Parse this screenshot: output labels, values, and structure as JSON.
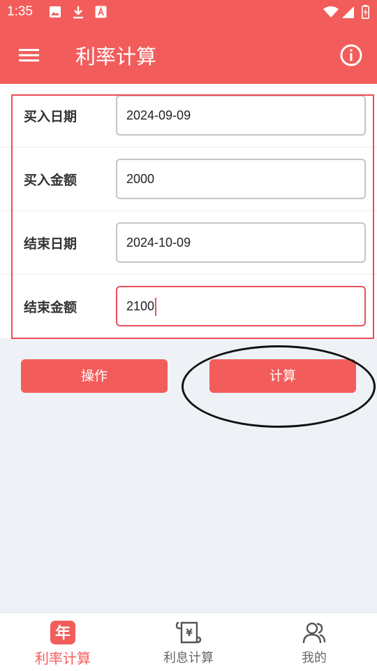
{
  "status_bar": {
    "time": "1:35",
    "icons": [
      "image-icon",
      "download-icon",
      "font-icon",
      "wifi-icon",
      "signal-icon",
      "battery-icon"
    ]
  },
  "app_bar": {
    "title": "利率计算",
    "menu_icon": "menu-icon",
    "info_icon": "info-icon"
  },
  "form": {
    "rows": [
      {
        "label": "买入日期",
        "value": "2024-09-09"
      },
      {
        "label": "买入金额",
        "value": "2000"
      },
      {
        "label": "结束日期",
        "value": "2024-10-09"
      },
      {
        "label": "结束金额",
        "value": "2100"
      }
    ]
  },
  "buttons": {
    "operate": "操作",
    "calculate": "计算"
  },
  "bottom_nav": {
    "items": [
      {
        "label": "利率计算",
        "icon_text": "年",
        "active": true
      },
      {
        "label": "利息计算",
        "icon_text": "¥",
        "active": false
      },
      {
        "label": "我的",
        "active": false
      }
    ]
  },
  "colors": {
    "primary": "#f25d5b",
    "highlight": "#ef4b54",
    "background": "#eef2f6"
  }
}
